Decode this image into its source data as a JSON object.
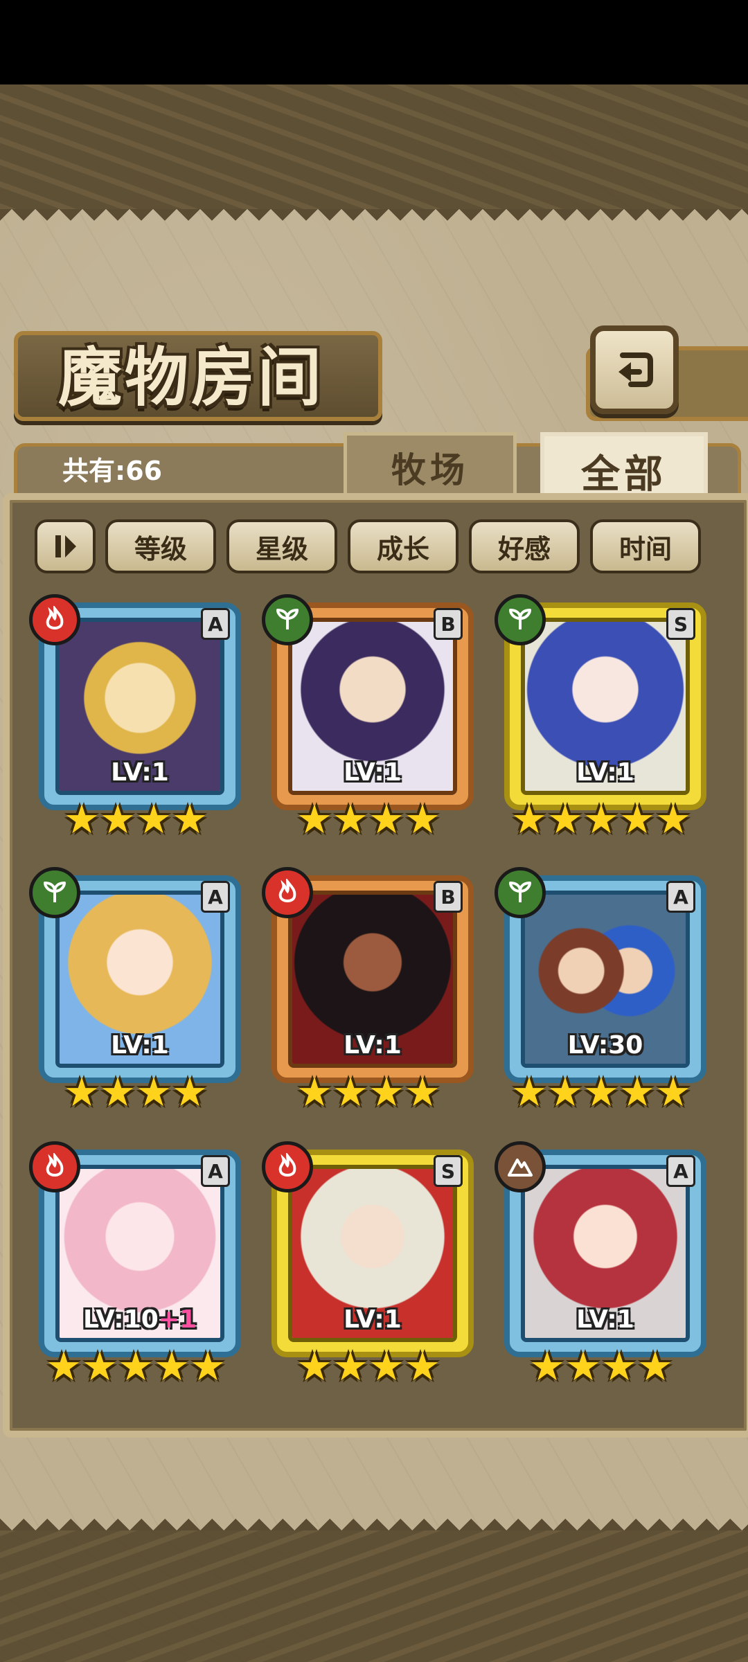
{
  "header": {
    "title": "魔物房间"
  },
  "tabs": {
    "count_label": "共有:66",
    "farm": "牧场",
    "all": "全部"
  },
  "sort": [
    "等级",
    "星级",
    "成长",
    "好感",
    "时间"
  ],
  "colors": {
    "frame_blue": "#7fc0e0",
    "frame_orange": "#e79a4e",
    "frame_gold": "#f3dc3a",
    "fire": "#d8322a",
    "leaf": "#3f7d2f",
    "rock": "#7a5238",
    "star": "#ffd21c"
  },
  "monsters": [
    {
      "level": "LV:1",
      "rank": "A",
      "element": "fire",
      "stars": 4,
      "frame": "blue"
    },
    {
      "level": "LV:1",
      "rank": "B",
      "element": "leaf",
      "stars": 4,
      "frame": "orange"
    },
    {
      "level": "LV:1",
      "rank": "S",
      "element": "leaf",
      "stars": 5,
      "frame": "gold"
    },
    {
      "level": "LV:1",
      "rank": "A",
      "element": "leaf",
      "stars": 4,
      "frame": "blue"
    },
    {
      "level": "LV:1",
      "rank": "B",
      "element": "fire",
      "stars": 4,
      "frame": "orange"
    },
    {
      "level": "LV:30",
      "rank": "A",
      "element": "leaf",
      "stars": 5,
      "frame": "blue"
    },
    {
      "level": "LV:10",
      "level_bonus": "+1",
      "rank": "A",
      "element": "fire",
      "stars": 5,
      "frame": "blue"
    },
    {
      "level": "LV:1",
      "rank": "S",
      "element": "fire",
      "stars": 4,
      "frame": "gold"
    },
    {
      "level": "LV:1",
      "rank": "A",
      "element": "rock",
      "stars": 4,
      "frame": "blue"
    }
  ]
}
